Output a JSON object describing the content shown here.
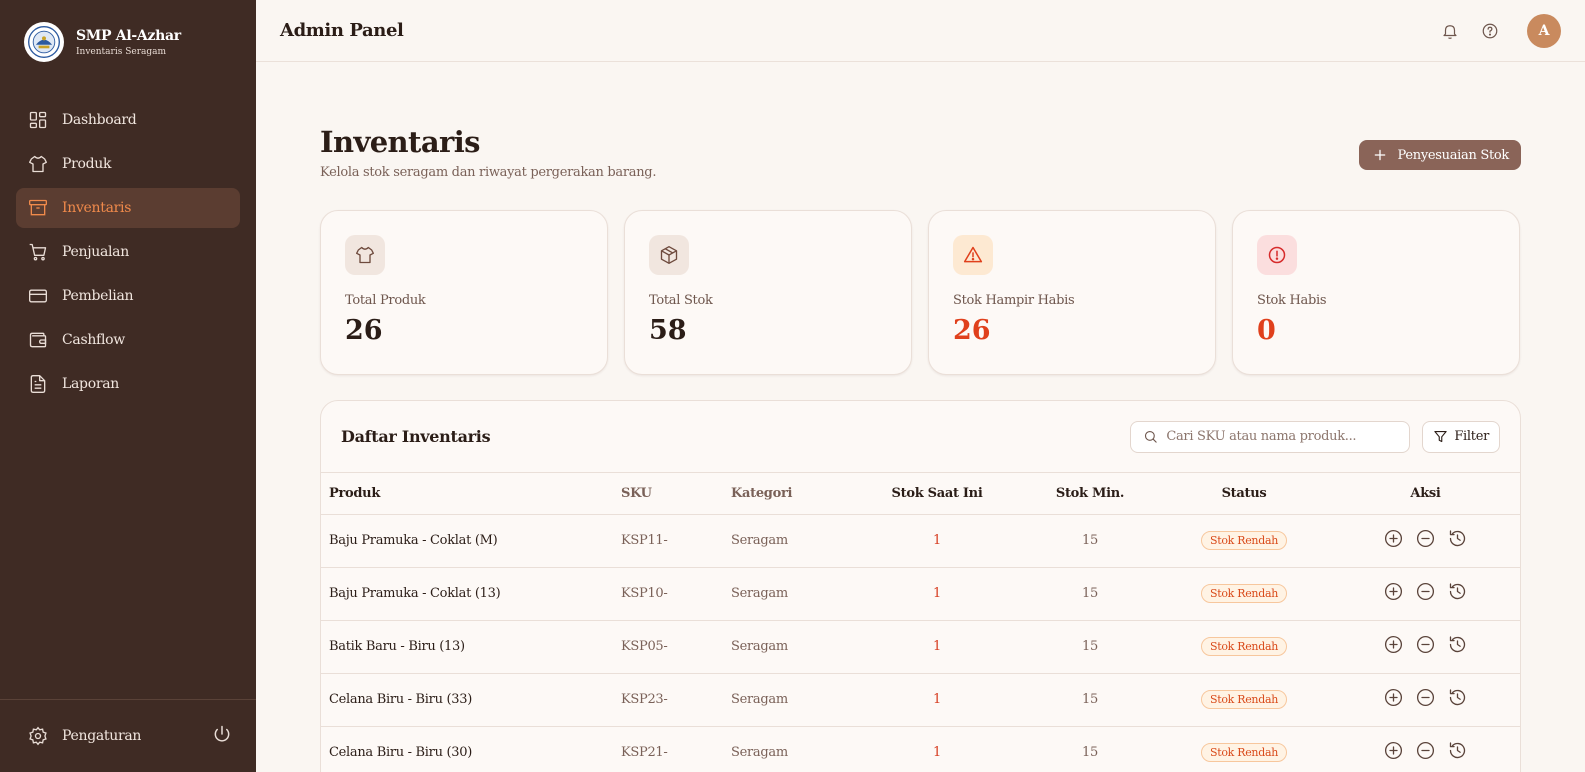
{
  "brand": {
    "name": "SMP Al-Azhar",
    "subtitle": "Inventaris Seragam"
  },
  "sidebar": {
    "items": [
      {
        "label": "Dashboard",
        "icon": "dashboard-icon",
        "active": false
      },
      {
        "label": "Produk",
        "icon": "shirt-icon",
        "active": false
      },
      {
        "label": "Inventaris",
        "icon": "archive-icon",
        "active": true
      },
      {
        "label": "Penjualan",
        "icon": "cart-icon",
        "active": false
      },
      {
        "label": "Pembelian",
        "icon": "credit-card-icon",
        "active": false
      },
      {
        "label": "Cashflow",
        "icon": "wallet-icon",
        "active": false
      },
      {
        "label": "Laporan",
        "icon": "document-icon",
        "active": false
      }
    ],
    "settings_label": "Pengaturan"
  },
  "header": {
    "title": "Admin Panel",
    "avatar_initial": "A"
  },
  "page": {
    "title": "Inventaris",
    "subtitle": "Kelola stok seragam dan riwayat pergerakan barang.",
    "adjust_button": "Penyesuaian Stok"
  },
  "stats": [
    {
      "label": "Total Produk",
      "value": "26",
      "icon": "shirt-icon",
      "value_color": "#2b1d17",
      "bg": "#f1e6df"
    },
    {
      "label": "Total Stok",
      "value": "58",
      "icon": "box-icon",
      "value_color": "#2b1d17",
      "bg": "#f1e6df"
    },
    {
      "label": "Stok Hampir Habis",
      "value": "26",
      "icon": "warning-icon",
      "value_color": "#e0401c",
      "bg": "#fde9d2"
    },
    {
      "label": "Stok Habis",
      "value": "0",
      "icon": "alert-circle-icon",
      "value_color": "#e0401c",
      "bg": "#fbdede"
    }
  ],
  "table": {
    "title": "Daftar Inventaris",
    "search_placeholder": "Cari SKU atau nama produk...",
    "filter_label": "Filter",
    "columns": [
      "Produk",
      "SKU",
      "Kategori",
      "Stok Saat Ini",
      "Stok Min.",
      "Status",
      "Aksi"
    ],
    "rows": [
      {
        "produk": "Baju Pramuka - Coklat (M)",
        "sku": "KSP11-",
        "kategori": "Seragam",
        "stok": "1",
        "min": "15",
        "status": "Stok Rendah"
      },
      {
        "produk": "Baju Pramuka - Coklat (13)",
        "sku": "KSP10-",
        "kategori": "Seragam",
        "stok": "1",
        "min": "15",
        "status": "Stok Rendah"
      },
      {
        "produk": "Batik Baru - Biru (13)",
        "sku": "KSP05-",
        "kategori": "Seragam",
        "stok": "1",
        "min": "15",
        "status": "Stok Rendah"
      },
      {
        "produk": "Celana Biru - Biru (33)",
        "sku": "KSP23-",
        "kategori": "Seragam",
        "stok": "1",
        "min": "15",
        "status": "Stok Rendah"
      },
      {
        "produk": "Celana Biru - Biru (30)",
        "sku": "KSP21-",
        "kategori": "Seragam",
        "stok": "1",
        "min": "15",
        "status": "Stok Rendah"
      }
    ]
  }
}
